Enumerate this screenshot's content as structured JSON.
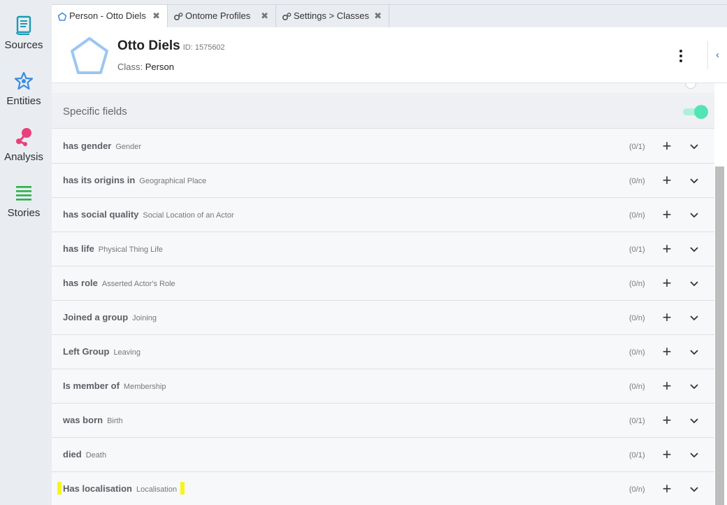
{
  "nav": {
    "items": [
      {
        "label": "Sources",
        "icon": "scroll-icon"
      },
      {
        "label": "Entities",
        "icon": "star-icon"
      },
      {
        "label": "Analysis",
        "icon": "analysis-icon"
      },
      {
        "label": "Stories",
        "icon": "lines-icon"
      }
    ]
  },
  "tabs": [
    {
      "label": "Person - Otto Diels",
      "icon": "pentagon-icon",
      "close": "✖"
    },
    {
      "label": "Ontome Profiles",
      "icon": "gears-icon",
      "close": "✖"
    },
    {
      "label": "Settings > Classes",
      "icon": "gears-icon",
      "close": "✖"
    }
  ],
  "entity": {
    "name": "Otto Diels",
    "id_label": "ID: 1575602",
    "class_prefix": "Class: ",
    "class_value": "Person"
  },
  "section": {
    "title": "Specific fields",
    "toggle_on": true
  },
  "fields": [
    {
      "name": "has gender",
      "class": "Gender",
      "cardinality": "(0/1)"
    },
    {
      "name": "has its origins in",
      "class": "Geographical Place",
      "cardinality": "(0/n)"
    },
    {
      "name": "has social quality",
      "class": "Social Location of an Actor",
      "cardinality": "(0/n)"
    },
    {
      "name": "has life",
      "class": "Physical Thing Life",
      "cardinality": "(0/1)"
    },
    {
      "name": "has role",
      "class": "Asserted Actor's Role",
      "cardinality": "(0/n)"
    },
    {
      "name": "Joined a group",
      "class": "Joining",
      "cardinality": "(0/n)"
    },
    {
      "name": "Left Group",
      "class": "Leaving",
      "cardinality": "(0/n)"
    },
    {
      "name": "Is member of",
      "class": "Membership",
      "cardinality": "(0/n)"
    },
    {
      "name": "was born",
      "class": "Birth",
      "cardinality": "(0/1)"
    },
    {
      "name": "died",
      "class": "Death",
      "cardinality": "(0/1)"
    },
    {
      "name": "Has localisation",
      "class": "Localisation",
      "cardinality": "(0/n)"
    }
  ],
  "colors": {
    "accent_blue": "#3a8be0",
    "sources_teal": "#1a9bb5",
    "analysis_pink": "#e8407a",
    "stories_green": "#2bb04a",
    "toggle_green": "#52e5b4",
    "highlight_yellow": "#f5f51a"
  }
}
